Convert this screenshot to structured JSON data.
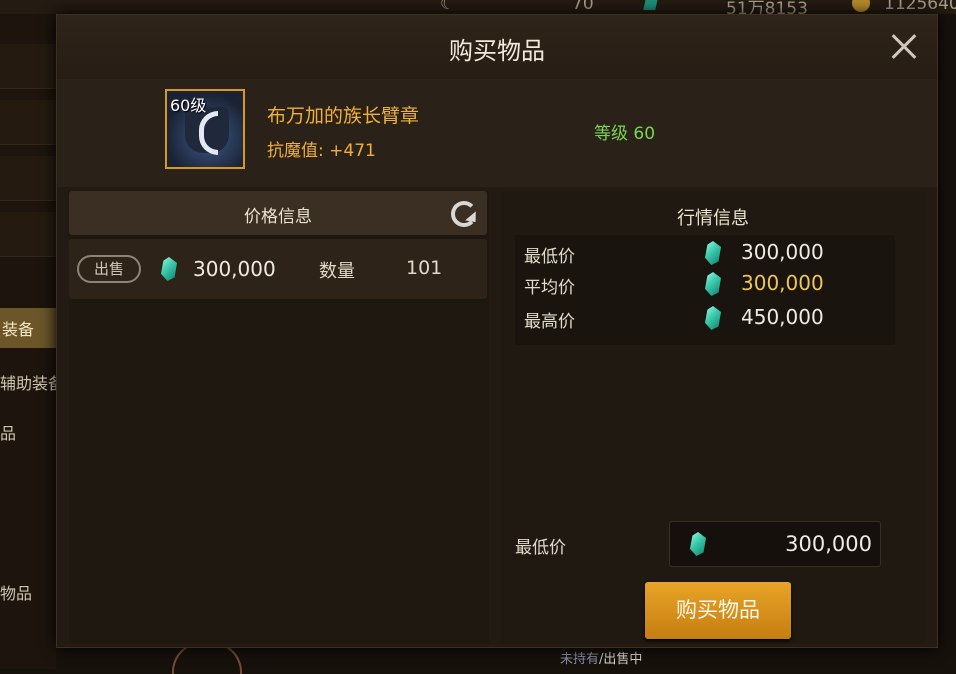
{
  "background": {
    "top_values": [
      "70",
      "51万8153",
      "1125640"
    ],
    "side_tabs": [
      "装备",
      "辅助装备",
      "品",
      "物品"
    ],
    "bottom_status": {
      "not_owned": "未持有",
      "separator": "/",
      "on_sale": "出售中"
    }
  },
  "dialog": {
    "title": "购买物品",
    "close_icon": "close-icon"
  },
  "item": {
    "level_tag": "60级",
    "name": "布万加的族长臂章",
    "stat": "抗魔值: +471",
    "level": "等级 60"
  },
  "price_info": {
    "header": "价格信息",
    "refresh_icon": "refresh-icon",
    "listings": [
      {
        "badge": "出售",
        "price": "300,000",
        "qty_label": "数量",
        "qty": "101"
      }
    ]
  },
  "market_info": {
    "title": "行情信息",
    "rows": [
      {
        "label": "最低价",
        "value": "300,000"
      },
      {
        "label": "平均价",
        "value": "300,000"
      },
      {
        "label": "最高价",
        "value": "450,000"
      }
    ]
  },
  "purchase": {
    "label": "最低价",
    "value": "300,000",
    "button": "购买物品"
  },
  "colors": {
    "item_name": "#f0b03a",
    "level_green": "#7ad455",
    "avg_price_gold": "#f0c45a",
    "button_orange": "#e8a427",
    "gem_teal": "#3fd0b0"
  }
}
